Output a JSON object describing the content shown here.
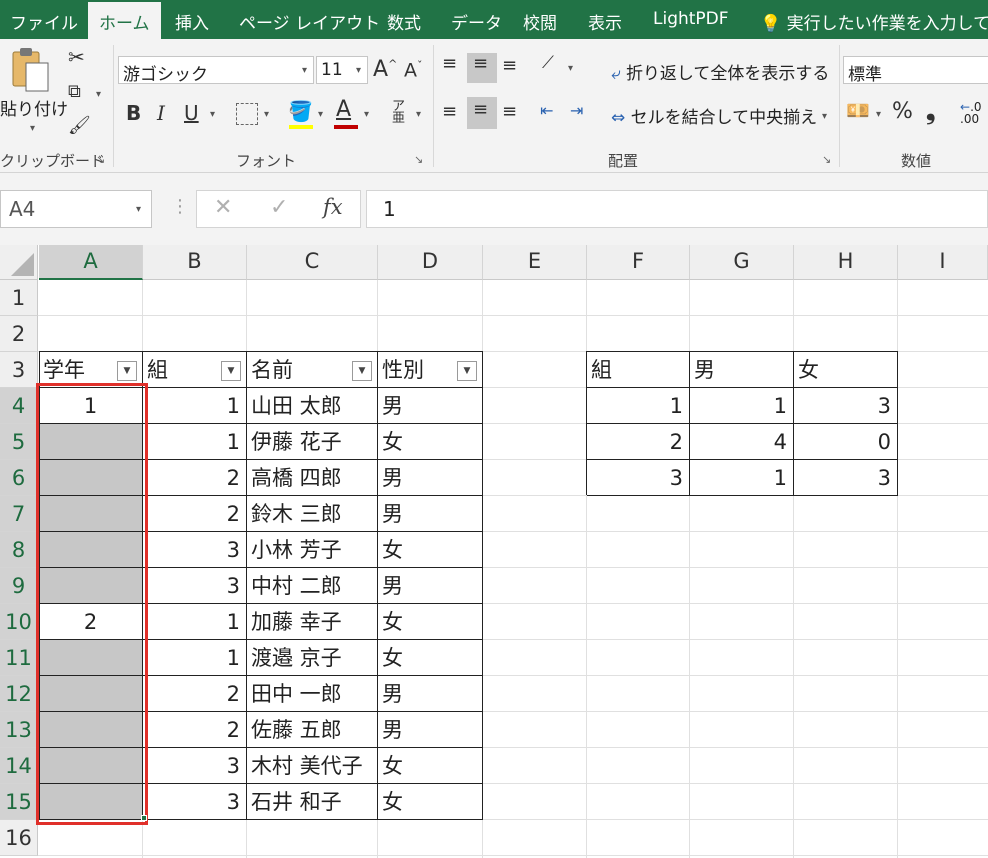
{
  "tabs": [
    "ファイル",
    "ホーム",
    "挿入",
    "ページ レイアウト",
    "数式",
    "データ",
    "校閲",
    "表示",
    "LightPDF",
    "実行したい作業を入力してく"
  ],
  "ribbon": {
    "clipboard": {
      "paste": "貼り付け",
      "label": "クリップボード"
    },
    "font": {
      "name": "游ゴシック",
      "size": "11",
      "label": "フォント",
      "bold": "B",
      "italic": "I",
      "underline": "U",
      "grow": "A",
      "shrink": "A"
    },
    "alignment": {
      "wrap": "折り返して全体を表示する",
      "merge": "セルを結合して中央揃え",
      "label": "配置"
    },
    "number": {
      "format": "標準",
      "label": "数値",
      "percent": "%",
      "comma": "❟"
    }
  },
  "formula_bar": {
    "name_box": "A4",
    "fx": "fx",
    "value": "1"
  },
  "columns": [
    "A",
    "B",
    "C",
    "D",
    "E",
    "F",
    "G",
    "H",
    "I"
  ],
  "rows": [
    "1",
    "2",
    "3",
    "4",
    "5",
    "6",
    "7",
    "8",
    "9",
    "10",
    "11",
    "12",
    "13",
    "14",
    "15",
    "16"
  ],
  "table1": {
    "headers": [
      "学年",
      "組",
      "名前",
      "性別"
    ],
    "rows": [
      [
        "1",
        "1",
        "山田 太郎",
        "男"
      ],
      [
        "",
        "1",
        "伊藤 花子",
        "女"
      ],
      [
        "",
        "2",
        "高橋 四郎",
        "男"
      ],
      [
        "",
        "2",
        "鈴木 三郎",
        "男"
      ],
      [
        "",
        "3",
        "小林 芳子",
        "女"
      ],
      [
        "",
        "3",
        "中村 二郎",
        "男"
      ],
      [
        "2",
        "1",
        "加藤 幸子",
        "女"
      ],
      [
        "",
        "1",
        "渡邉 京子",
        "女"
      ],
      [
        "",
        "2",
        "田中 一郎",
        "男"
      ],
      [
        "",
        "2",
        "佐藤 五郎",
        "男"
      ],
      [
        "",
        "3",
        "木村 美代子",
        "女"
      ],
      [
        "",
        "3",
        "石井 和子",
        "女"
      ]
    ]
  },
  "table2": {
    "headers": [
      "組",
      "男",
      "女"
    ],
    "rows": [
      [
        "1",
        "1",
        "3"
      ],
      [
        "2",
        "4",
        "0"
      ],
      [
        "3",
        "1",
        "3"
      ]
    ]
  },
  "colors": {
    "excel_green": "#217346",
    "selection_border": "#e0302a",
    "selection_fill": "#c7c7c7"
  }
}
